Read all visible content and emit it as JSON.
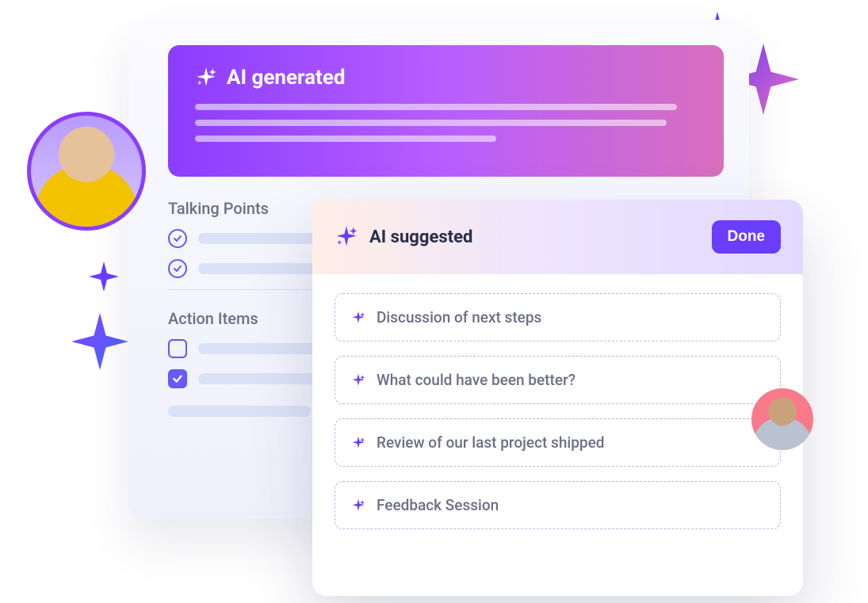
{
  "generated": {
    "title": "AI generated"
  },
  "talking_points": {
    "title": "Talking Points"
  },
  "action_items": {
    "title": "Action Items"
  },
  "suggested": {
    "title": "AI suggested",
    "done_label": "Done",
    "items": [
      "Discussion of next steps",
      "What could have been better?",
      "Review of our last project shipped",
      "Feedback Session"
    ]
  }
}
